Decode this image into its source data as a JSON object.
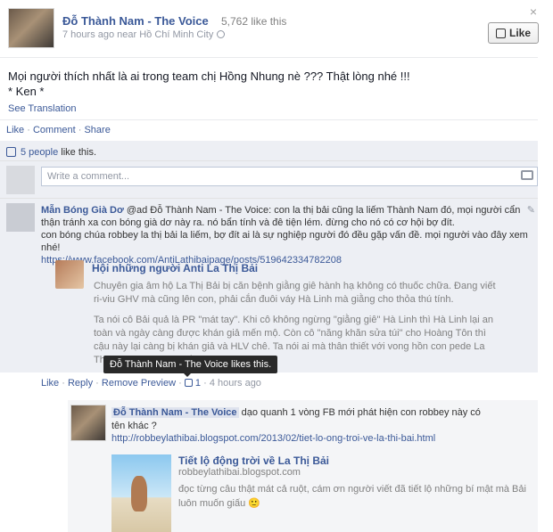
{
  "post": {
    "author": "Đỗ Thành Nam - The Voice",
    "likes": "5,762 like this",
    "meta": "7 hours ago near Hồ Chí Minh City",
    "close": "×",
    "like_button": "Like",
    "text_line1": "Mọi người thích nhất là ai trong team chị Hồng Nhung nè ??? Thật lòng nhé !!!",
    "text_line2": "* Ken *",
    "see_translation": "See Translation",
    "actions": {
      "like": "Like",
      "comment": "Comment",
      "share": "Share",
      "dot": "·"
    },
    "people_like_count": "5 people",
    "people_like_suffix": " like this.",
    "write_placeholder": "Write a comment..."
  },
  "comment1": {
    "name": "Mẫn Bóng Già Dơ",
    "text1": " @ad Đỗ Thành Nam - The Voice: con la thị bải cũng la liếm Thành Nam đó, mọi người cẩn thận tránh xa con bóng già dơ này ra. nó bẩn tính và đê tiện lém. đừng cho nó có cơ hội bợ đít.",
    "text2": "con bóng chúa robbey la thị bải la liếm, bợ đít ai là sự nghiệp người đó đều gặp vấn đề. mọi người vào đây xem nhé!",
    "link": "https://www.facebook.com/AntiLathibaipage/posts/519642334782208",
    "preview_title": "Hội những người Anti La Thị Bải",
    "preview_body1": "Chuyên gia âm hộ La Thị Bải bị căn bệnh giằng giê hành hạ không có thuốc chữa. Đang viết ri-viu GHV mà cũng lên con, phải cắn đuôi váy Hà Linh mà giằng cho thỏa thú tính.",
    "preview_body2": "Ta nói cô Bải quả là PR \"mát tay\". Khi cô không ngừng \"giằng giê\" Hà Linh thì Hà Linh lại an toàn và ngày càng được khán giả mến mộ. Còn cô \"năng khăn sửa túi\" cho Hoàng Tôn thì cậu này lại càng bị khán giả và HLV chê. Ta nói ai mà thân thiết với vong hồn con pede La Thị Bải thì sự nghiệp rồi cũng sẽ",
    "actions": {
      "like": "Like",
      "reply": "Reply",
      "remove_preview": "Remove Preview",
      "like_count": "1",
      "time": "4 hours ago",
      "dot": "·"
    },
    "tooltip": "Đỗ Thành Nam - The Voice likes this."
  },
  "reply": {
    "name": "Đỗ Thành Nam - The Voice",
    "text": " dạo quanh 1 vòng FB mới phát hiện con robbey này có tên khác ?",
    "link": "http://robbeylathibai.blogspot.com/2013/02/tiet-lo-ong-troi-ve-la-thi-bai.html",
    "share_title": "Tiết lộ động trời về La Thị Bải",
    "share_domain": "robbeylathibai.blogspot.com",
    "share_desc": "đọc từng câu thật mát cả ruột, cám ơn người viết đã tiết lộ những bí mật mà Bải luôn muốn giấu",
    "emoji": "🙂"
  },
  "colors": {
    "link": "#3b5998",
    "ufi_bg": "#edeff4",
    "tooltip_bg": "#292929"
  }
}
